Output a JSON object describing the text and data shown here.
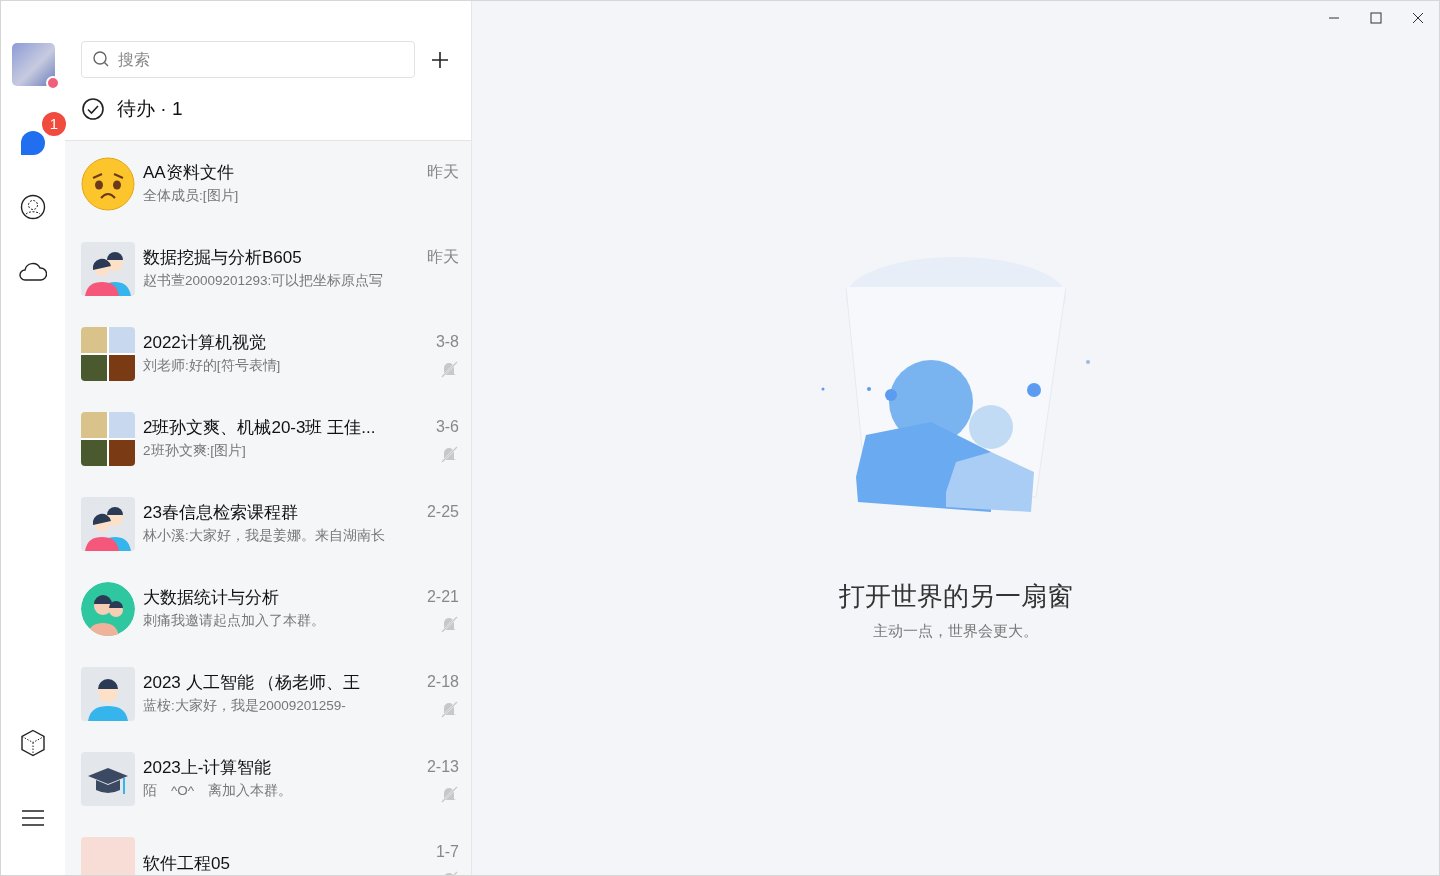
{
  "rail": {
    "profile": {
      "status_badge": true
    },
    "chat_badge": "1"
  },
  "search": {
    "placeholder": "搜索"
  },
  "todo": {
    "label": "待办 · 1"
  },
  "chats": [
    {
      "title": "AA资料文件",
      "preview": "全体成员:[图片]",
      "time": "昨天",
      "muted": false,
      "avatar": {
        "kind": "emoji"
      }
    },
    {
      "title": "数据挖掘与分析B605",
      "preview": "赵书萱20009201293:可以把坐标原点写",
      "time": "昨天",
      "muted": false,
      "avatar": {
        "kind": "group"
      }
    },
    {
      "title": "2022计算机视觉",
      "preview": "刘老师:好的[符号表情]",
      "time": "3-8",
      "muted": true,
      "avatar": {
        "kind": "grid"
      }
    },
    {
      "title": "2班孙文爽、机械20-3班 王佳...",
      "preview": "2班孙文爽:[图片]",
      "time": "3-6",
      "muted": true,
      "avatar": {
        "kind": "grid"
      }
    },
    {
      "title": "23春信息检索课程群",
      "preview": "林小溪:大家好，我是姜娜。来自湖南长",
      "time": "2-25",
      "muted": false,
      "avatar": {
        "kind": "group"
      }
    },
    {
      "title": "大数据统计与分析",
      "preview": "刺痛我邀请起点加入了本群。",
      "time": "2-21",
      "muted": true,
      "avatar": {
        "kind": "circle"
      }
    },
    {
      "title": "2023 人工智能 （杨老师、王",
      "preview": "蓝桉:大家好，我是20009201259-",
      "time": "2-18",
      "muted": true,
      "avatar": {
        "kind": "person"
      }
    },
    {
      "title": "2023上-计算智能",
      "preview": "陌　^O^　离加入本群。",
      "time": "2-13",
      "muted": true,
      "avatar": {
        "kind": "cap"
      }
    },
    {
      "title": "软件工程05",
      "time": "1-7",
      "muted": true,
      "avatar": {
        "kind": "photo"
      }
    }
  ],
  "empty_state": {
    "title": "打开世界的另一扇窗",
    "subtitle": "主动一点，世界会更大。"
  }
}
